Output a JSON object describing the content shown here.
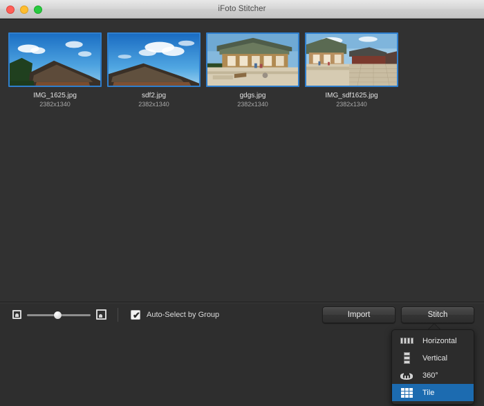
{
  "window": {
    "title": "iFoto Stitcher",
    "traffic_lights": [
      {
        "name": "close",
        "color": "#ff5f57"
      },
      {
        "name": "minimize",
        "color": "#ffbd2e"
      },
      {
        "name": "maximize",
        "color": "#28c940"
      }
    ]
  },
  "theme": {
    "content_bg": "#313131",
    "toolbar_bg": "#2e2e2e",
    "selection_blue": "#2f7fce",
    "menu_highlight": "#1c6bb0",
    "text_primary": "#e3e3e3",
    "text_secondary": "#a8a8a8"
  },
  "content": {
    "thumbnails": [
      {
        "name": "IMG_1625.jpg",
        "dimensions": "2382x1340",
        "selected": true
      },
      {
        "name": "sdf2.jpg",
        "dimensions": "2382x1340",
        "selected": true
      },
      {
        "name": "gdgs.jpg",
        "dimensions": "2382x1340",
        "selected": true
      },
      {
        "name": "IMG_sdf1625.jpg",
        "dimensions": "2382x1340",
        "selected": true
      }
    ]
  },
  "toolbar": {
    "zoom_slider": {
      "small_icon": "small-image-icon",
      "large_icon": "large-image-icon",
      "value_percent": 45
    },
    "auto_select": {
      "label": "Auto-Select by Group",
      "checked": true,
      "check_glyph": "✔"
    },
    "import_label": "Import",
    "stitch_label": "Stitch"
  },
  "stitch_menu": {
    "visible": true,
    "items": [
      {
        "label": "Horizontal",
        "icon": "horizontal-layout-icon",
        "selected": false
      },
      {
        "label": "Vertical",
        "icon": "vertical-layout-icon",
        "selected": false
      },
      {
        "label": "360°",
        "icon": "panorama-360-icon",
        "selected": false
      },
      {
        "label": "Tile",
        "icon": "tile-layout-icon",
        "selected": true
      }
    ]
  }
}
